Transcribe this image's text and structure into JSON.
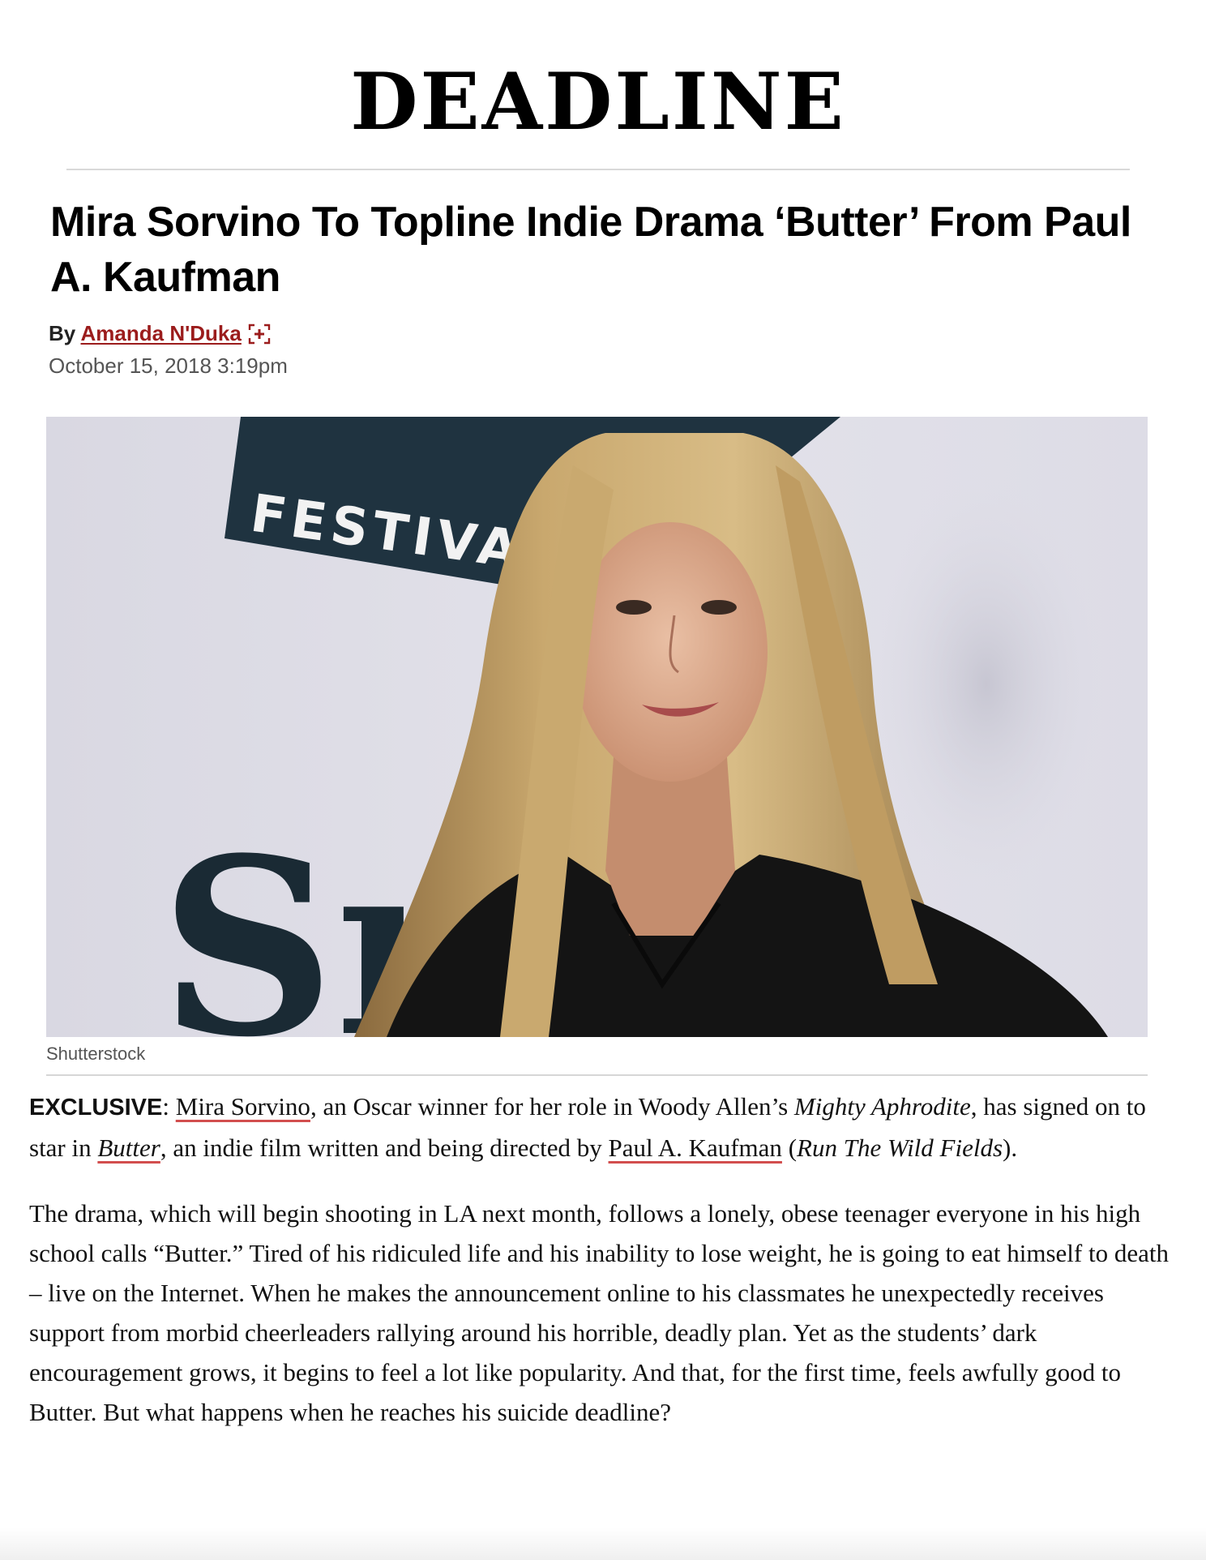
{
  "site": {
    "logo": "DEADLINE"
  },
  "article": {
    "headline": "Mira Sorvino To Topline Indie Drama ‘Butter’ From Paul A. Kaufman",
    "byline_prefix": "By",
    "author": "Amanda N'Duka",
    "date": "October 15, 2018 3:19pm",
    "image": {
      "banner_text": "FESTIVA",
      "partial_letters": "Sı",
      "credit": "Shutterstock"
    },
    "p1": {
      "exclusive": "EXCLUSIVE",
      "sep": ": ",
      "link1": "Mira Sorvino",
      "t1": ", an Oscar winner for her role in Woody Allen’s ",
      "em1": "Mighty Aphrodite",
      "t2": ", has signed on to star in ",
      "link2": "Butter",
      "t3": ", an indie film written and being directed by ",
      "link3": "Paul A. Kaufman",
      "t4": " (",
      "em2": "Run The Wild Fields",
      "t5": ")."
    },
    "p2": "The drama, which will begin shooting in LA next month, follows a lonely, obese teenager everyone in his high school calls “Butter.” Tired of his ridiculed life and his inability to lose weight, he is going to eat himself to death – live on the Internet. When he makes the announcement online to his classmates he unexpectedly receives support from morbid cheerleaders rallying around his horrible, deadly plan. Yet as the students’ dark encouragement grows, it begins to feel a lot like popularity. And that, for the first time, feels awfully good to Butter. But what happens when he reaches his suicide deadline?"
  },
  "colors": {
    "author_link": "#9b1c1c",
    "link_underline": "#d24e4e"
  },
  "icons": {
    "author_follow": "plus-icon"
  }
}
